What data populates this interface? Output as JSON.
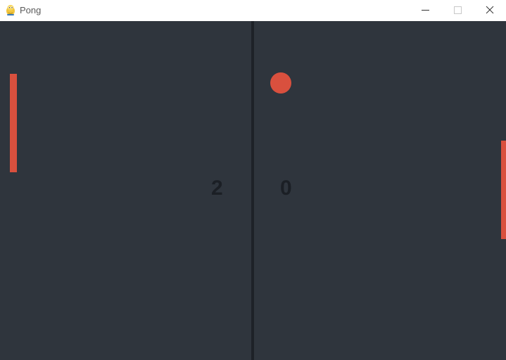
{
  "window": {
    "title": "Pong",
    "app_icon": "python-snake-icon",
    "controls": {
      "minimize_icon": "minimize-icon",
      "maximize_icon": "maximize-icon",
      "close_icon": "close-icon"
    }
  },
  "game": {
    "score": {
      "left": "2",
      "right": "0"
    },
    "colors": {
      "background": "#2f353d",
      "net": "#1e2228",
      "paddle": "#d9503e",
      "ball": "#d9503e",
      "score_text": "#1b1f25"
    }
  }
}
